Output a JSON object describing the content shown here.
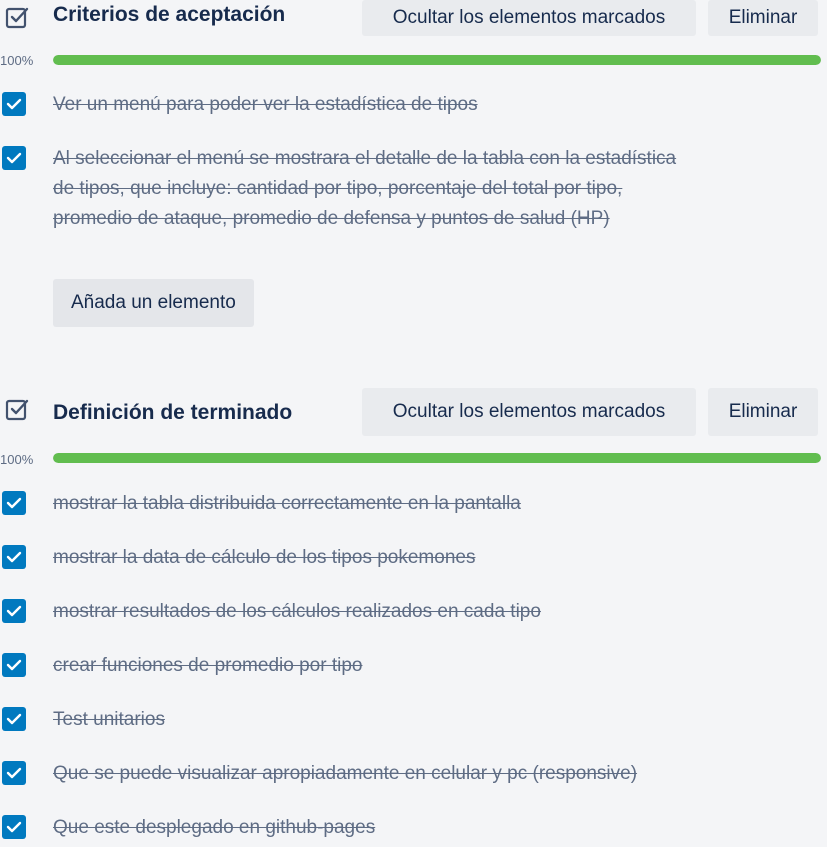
{
  "checklists": [
    {
      "title": "Criterios de aceptación",
      "hide_checked_label": "Ocultar los elementos marcados",
      "delete_label": "Eliminar",
      "progress_label": "100%",
      "progress": 1.0,
      "add_item_label": "Añada un elemento",
      "items": [
        {
          "text": "Ver un menú para poder ver la estadística de tipos",
          "checked": true
        },
        {
          "text": "Al seleccionar el menú se mostrara el detalle de la tabla con la estadística de tipos, que incluye: cantidad por tipo, porcentaje del total por tipo, promedio de ataque, promedio de defensa y puntos de salud (HP)",
          "checked": true
        }
      ]
    },
    {
      "title": "Definición de terminado",
      "hide_checked_label": "Ocultar los elementos marcados",
      "delete_label": "Eliminar",
      "progress_label": "100%",
      "progress": 1.0,
      "items": [
        {
          "text": "mostrar la tabla distribuida correctamente en la pantalla",
          "checked": true
        },
        {
          "text": "mostrar la data de cálculo de los tipos pokemones",
          "checked": true
        },
        {
          "text": "mostrar resultados de los cálculos realizados en cada tipo",
          "checked": true
        },
        {
          "text": "crear funciones de promedio por tipo",
          "checked": true
        },
        {
          "text": "Test unitarios",
          "checked": true
        },
        {
          "text": "Que se puede visualizar apropiadamente en celular y pc (responsive)",
          "checked": true
        },
        {
          "text": "Que este desplegado en github-pages",
          "checked": true
        }
      ]
    }
  ],
  "colors": {
    "accent": "#0079bf",
    "progress": "#61bd4f",
    "done_text": "#5e6c84"
  }
}
